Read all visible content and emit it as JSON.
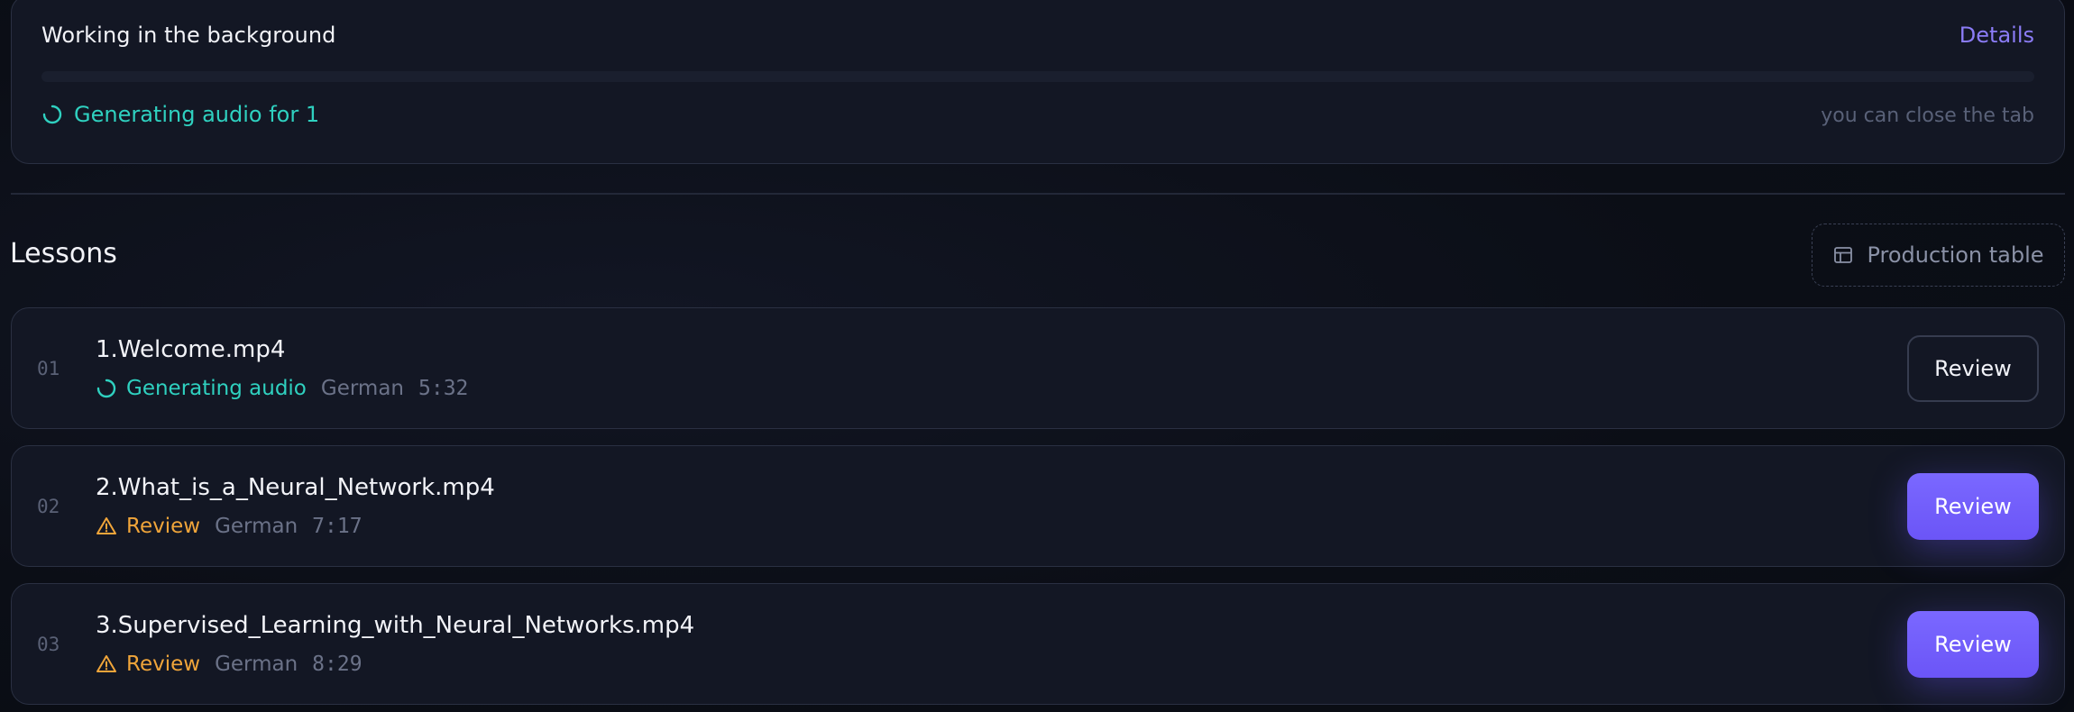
{
  "job": {
    "title": "Working in the background",
    "details_label": "Details",
    "status_text": "Generating audio for 1",
    "note": "you can close the tab",
    "progress": 0
  },
  "lessons_header": {
    "title": "Lessons",
    "production_table_label": "Production table"
  },
  "lessons": [
    {
      "number": "01",
      "title": "1.Welcome.mp4",
      "status": "Generating audio",
      "status_icon": "spinner-icon",
      "language": "German",
      "duration": "5:32",
      "review_label": "Review"
    },
    {
      "number": "02",
      "title": "2.What_is_a_Neural_Network.mp4",
      "status": "Review",
      "status_icon": "warning-icon",
      "language": "German",
      "duration": "7:17",
      "review_label": "Review"
    },
    {
      "number": "03",
      "title": "3.Supervised_Learning_with_Neural_Networks.mp4",
      "status": "Review",
      "status_icon": "warning-icon",
      "language": "German",
      "duration": "8:29",
      "review_label": "Review"
    }
  ],
  "colors": {
    "accent": "#7a68ff",
    "status_generating": "#2fd1c0",
    "status_review": "#f0a53a"
  }
}
